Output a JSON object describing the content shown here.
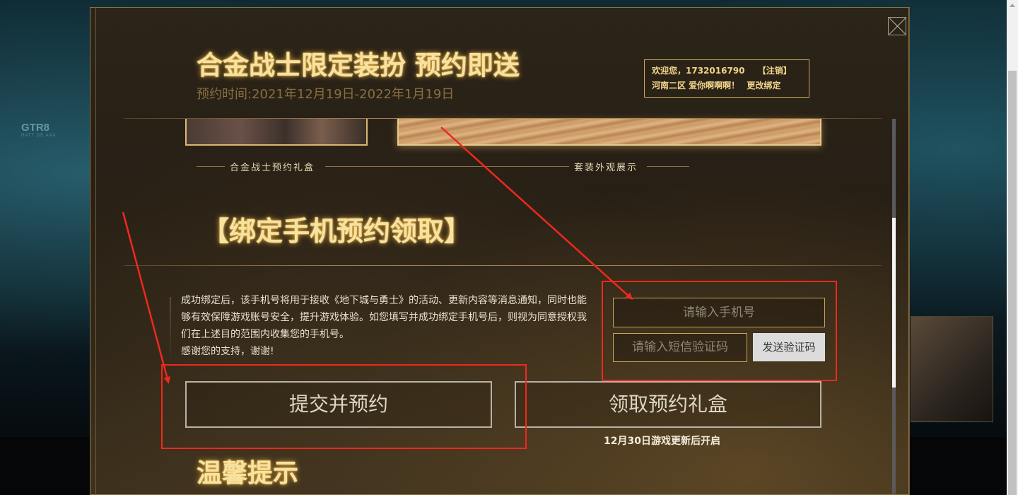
{
  "modal": {
    "title": "合金战士限定装扮 预约即送",
    "subtitle": "预约时间:2021年12月19日-2022年1月19日",
    "user": {
      "welcome": "欢迎您，1732016790",
      "logout": "【注销】",
      "server_info": "河南二区 爱你啊啊啊！",
      "change_bind": "更改绑定"
    },
    "captions": {
      "gift_box": "合金战士预约礼盒",
      "outfit_preview": "套装外观展示"
    },
    "bind_section": {
      "title": "【绑定手机预约领取】",
      "description": "成功绑定后，该手机号将用于接收《地下城与勇士》的活动、更新内容等消息通知，同时也能够有效保障游戏账号安全，提升游戏体验。如您填写并成功绑定手机号后，则视为同意授权我们在上述目的范围内收集您的手机号。",
      "thanks": "感谢您的支持，谢谢!",
      "phone_placeholder": "请输入手机号",
      "code_placeholder": "请输入短信验证码",
      "send_code": "发送验证码"
    },
    "buttons": {
      "submit": "提交并预约",
      "claim": "领取预约礼盒",
      "claim_note": "12月30日游戏更新后开启"
    },
    "tips_title": "温馨提示"
  },
  "background": {
    "left_text": "GTR8",
    "left_subtext": "HATT DE AAA"
  },
  "colors": {
    "gold_text": "#f6e2a3",
    "gold_border": "#c9a85c",
    "annotation_red": "#f0281e"
  },
  "icons": {
    "close": "close-icon",
    "scroll_up": "chevron-up-icon"
  }
}
